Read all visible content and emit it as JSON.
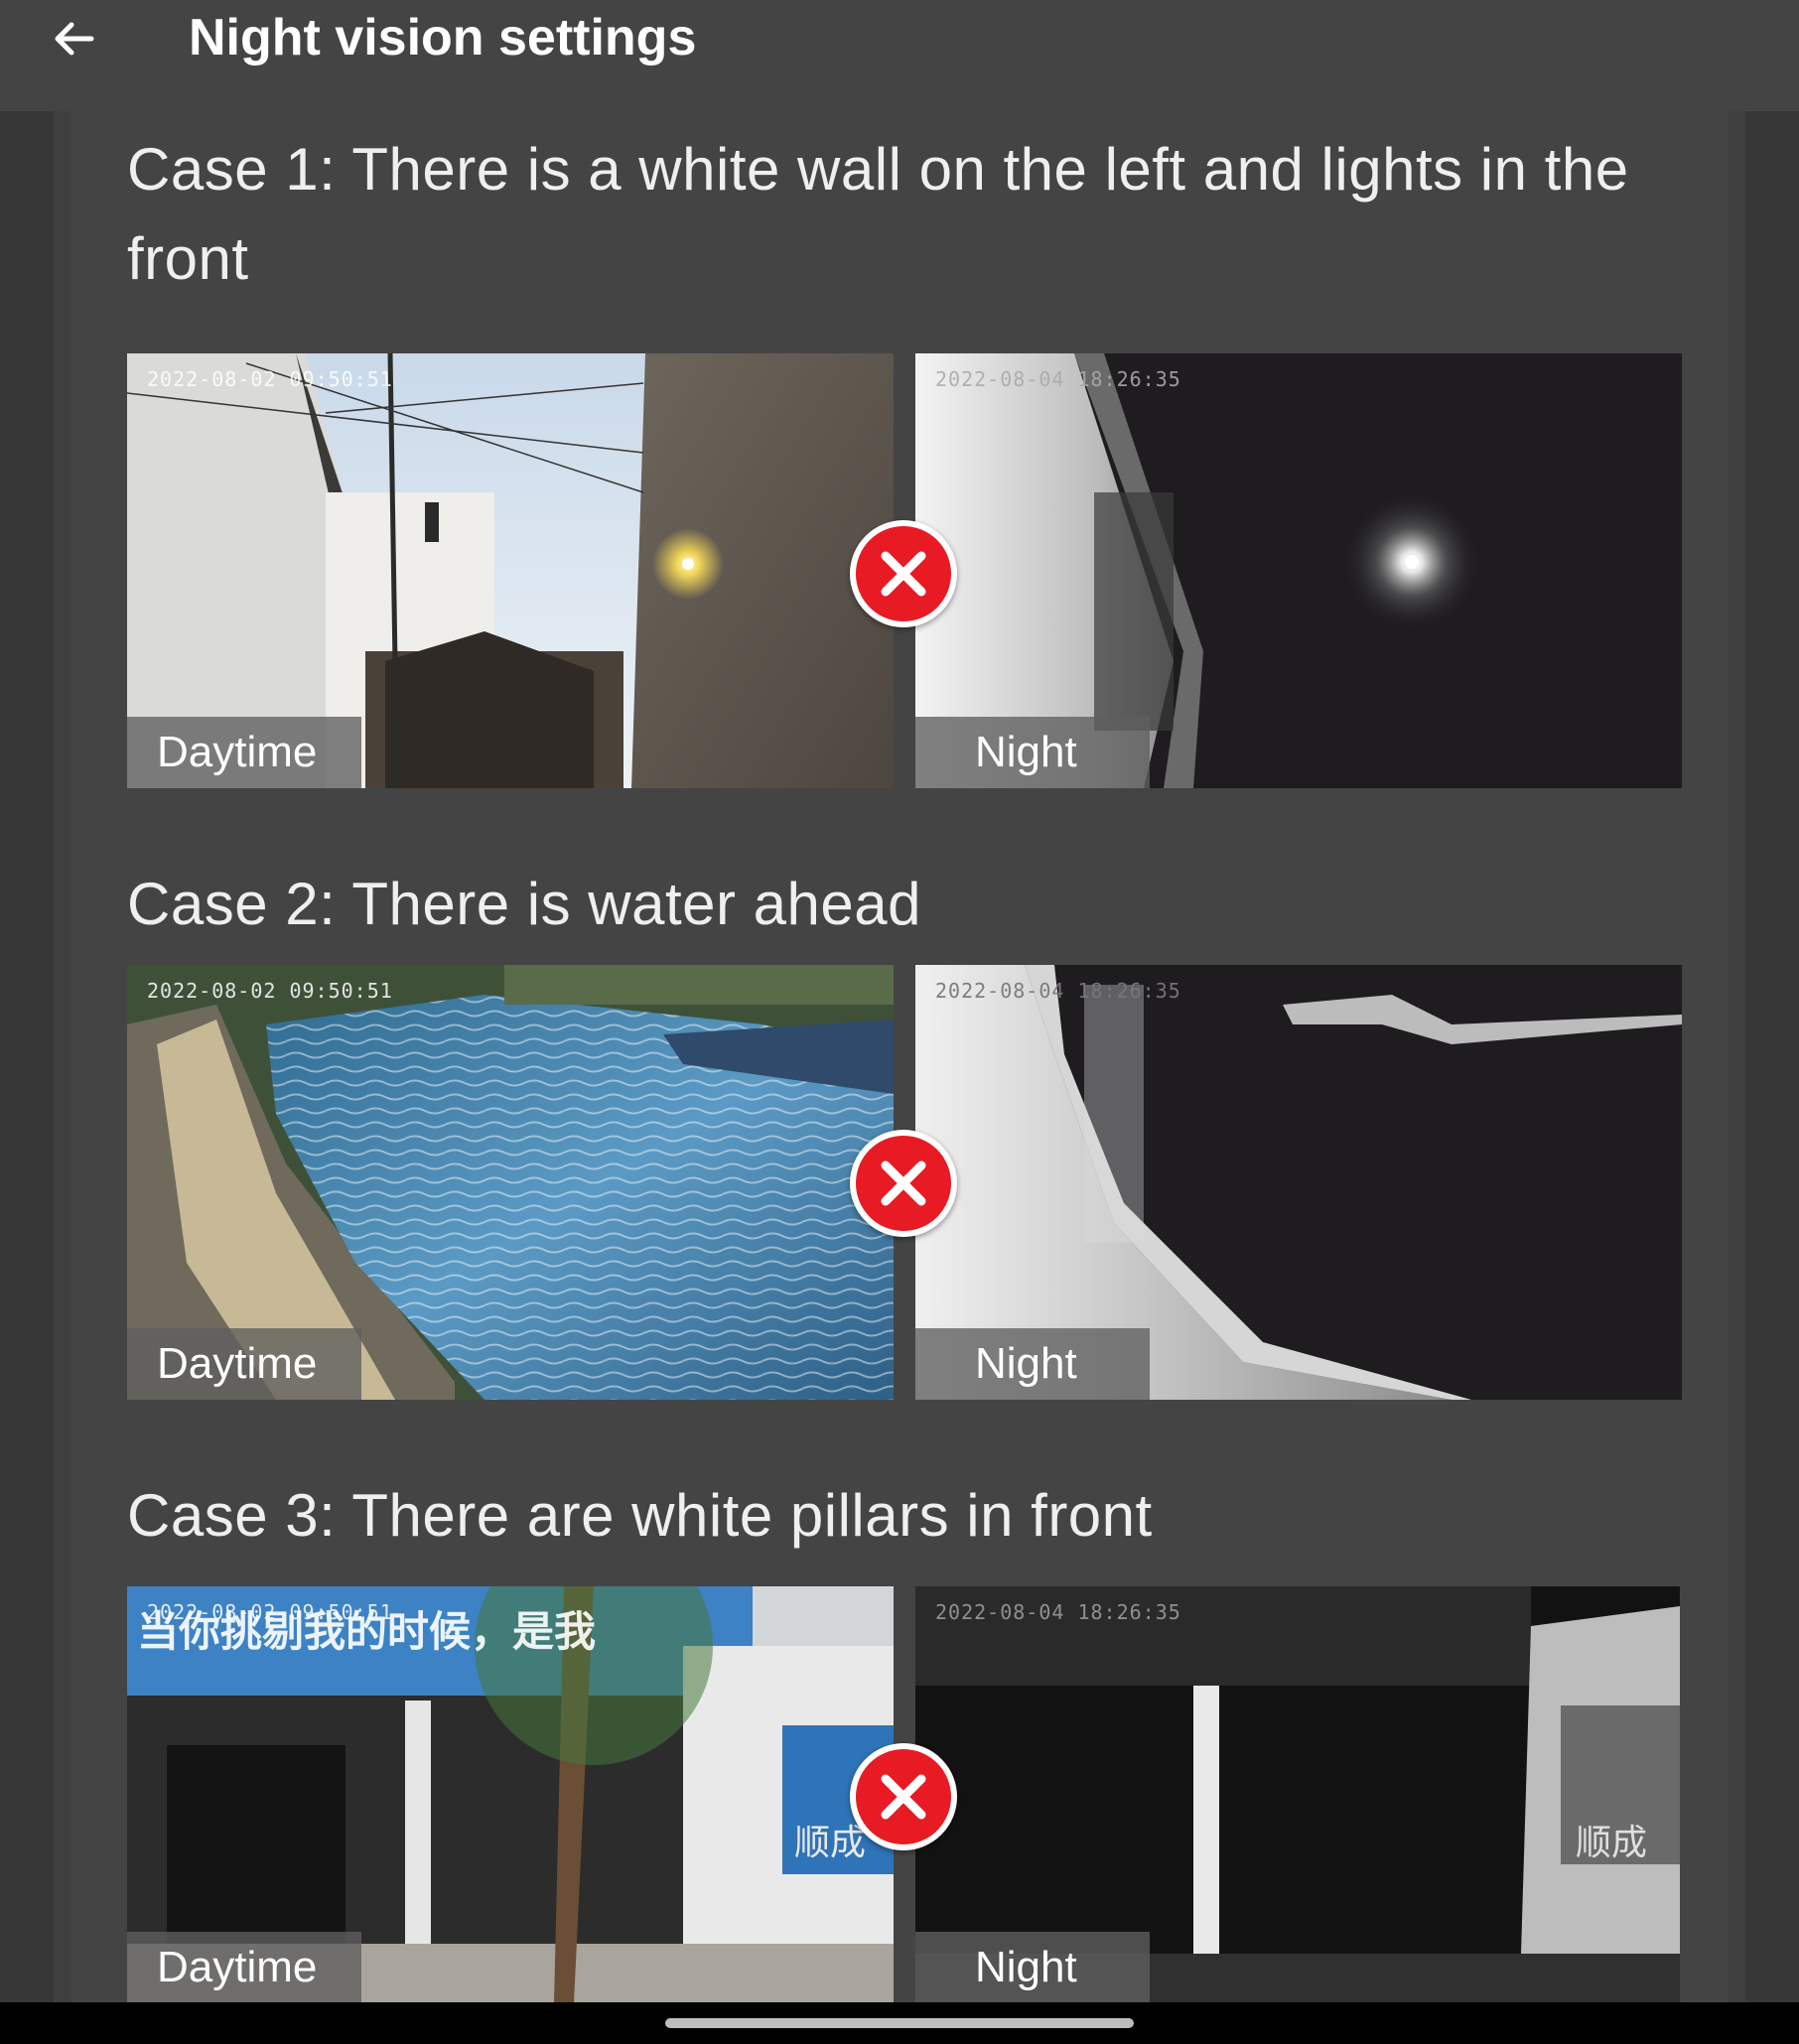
{
  "appbar": {
    "title": "Night vision settings",
    "back_icon": "arrow-left-icon"
  },
  "cases": [
    {
      "title": "Case 1: There is a white wall on the left and lights in the front",
      "day": {
        "caption": "Daytime",
        "timestamp": "2022-08-02 09:50:51"
      },
      "night": {
        "caption": "Night",
        "timestamp": "2022-08-04 18:26:35"
      },
      "status_icon": "red-x-icon"
    },
    {
      "title": "Case 2: There is water ahead",
      "day": {
        "caption": "Daytime",
        "timestamp": "2022-08-02 09:50:51"
      },
      "night": {
        "caption": "Night",
        "timestamp": "2022-08-04 18:26:35"
      },
      "status_icon": "red-x-icon"
    },
    {
      "title": "Case 3: There are white pillars in front",
      "day": {
        "caption": "Daytime",
        "timestamp": "2022-08-02 09:50:51",
        "banner_text": "当你挑剔我的时候，是我",
        "sign_text": "顺成"
      },
      "night": {
        "caption": "Night",
        "timestamp": "2022-08-04 18:26:35",
        "sign_text": "顺成"
      },
      "status_icon": "red-x-icon"
    }
  ],
  "colors": {
    "accent_x": "#e81a24",
    "appbar": "#444444",
    "background": "#3a3a3a"
  }
}
